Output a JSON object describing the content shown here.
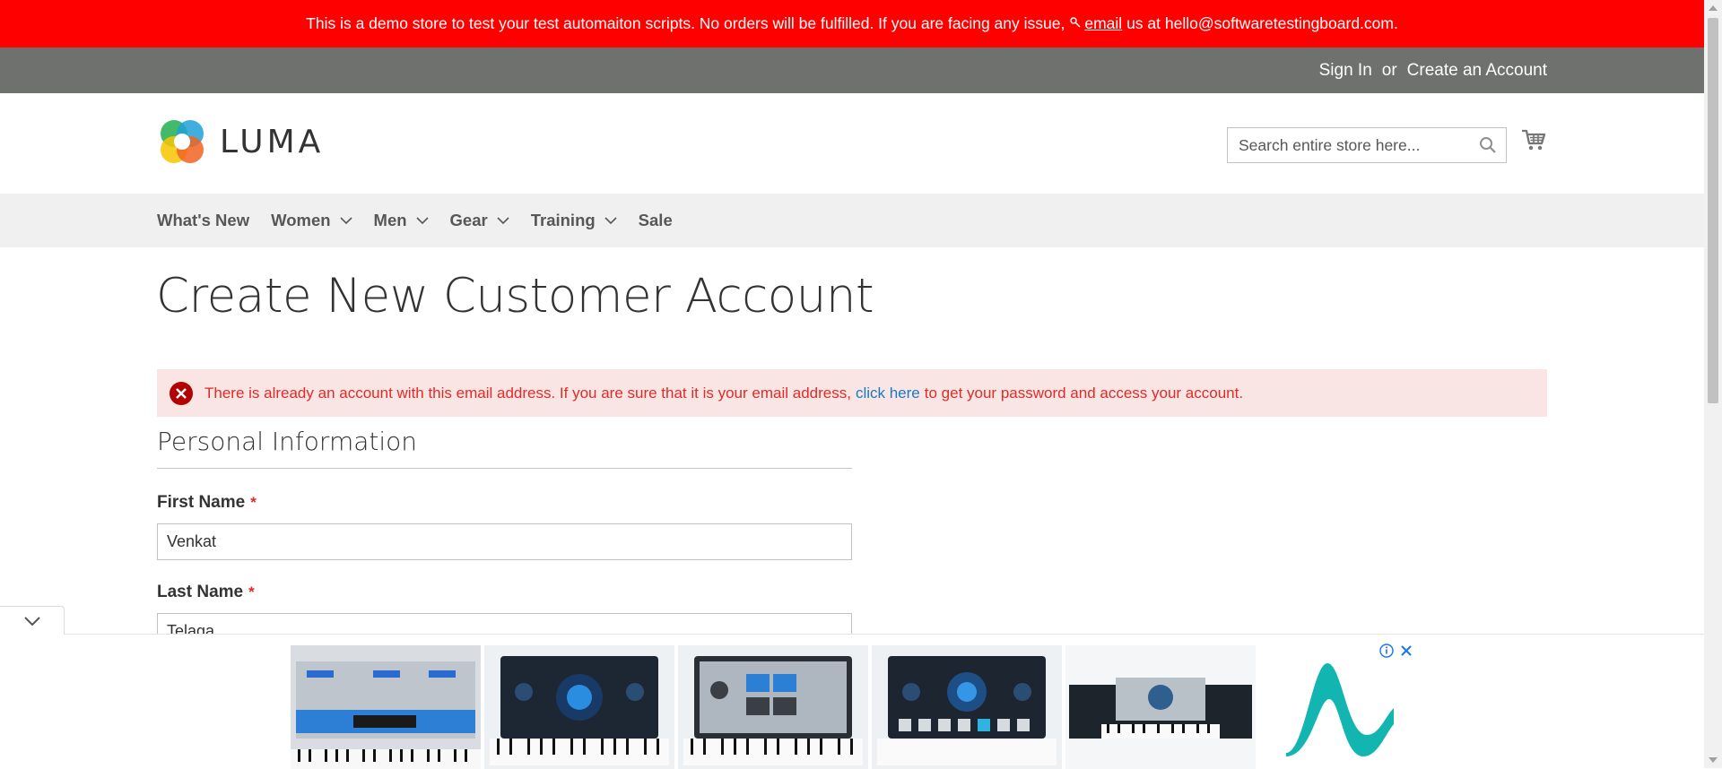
{
  "demo_notice": {
    "text_before": "This is a demo store to test your test automaiton scripts. No orders will be fulfilled. If you are facing any issue,",
    "key_icon": "key-icon",
    "link_text": "email",
    "text_after": "us at hello@softwaretestingboard.com."
  },
  "header_links": {
    "sign_in": "Sign In",
    "or": "or",
    "create_account": "Create an Account"
  },
  "logo": {
    "text": "LUMA"
  },
  "search": {
    "placeholder": "Search entire store here...",
    "value": ""
  },
  "nav": {
    "items": [
      {
        "label": "What's New",
        "has_dropdown": false
      },
      {
        "label": "Women",
        "has_dropdown": true
      },
      {
        "label": "Men",
        "has_dropdown": true
      },
      {
        "label": "Gear",
        "has_dropdown": true
      },
      {
        "label": "Training",
        "has_dropdown": true
      },
      {
        "label": "Sale",
        "has_dropdown": false
      }
    ]
  },
  "page": {
    "title": "Create New Customer Account"
  },
  "error": {
    "text_before": "There is already an account with this email address. If you are sure that it is your email address,",
    "link": "click here",
    "text_after": "to get your password and access your account."
  },
  "form": {
    "legend": "Personal Information",
    "first_name": {
      "label": "First Name",
      "required_mark": "*",
      "value": "Venkat"
    },
    "last_name": {
      "label": "Last Name",
      "required_mark": "*",
      "value": "Telaga"
    }
  },
  "ad": {
    "tiles": [
      "ad-image-1",
      "ad-image-2",
      "ad-image-3",
      "ad-image-4",
      "ad-image-5",
      "ad-image-6"
    ]
  },
  "colors": {
    "notice_bg": "#ff0000",
    "panel_bg": "#6e716e",
    "nav_bg": "#f0f0f0",
    "error_bg": "#fae5e5",
    "error_text": "#e02b27",
    "link": "#1979c3"
  }
}
